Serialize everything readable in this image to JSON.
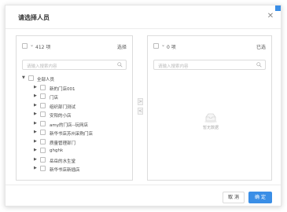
{
  "dialog": {
    "title": "请选择人员",
    "close_symbol": "✕"
  },
  "left_panel": {
    "count_label": "412 项",
    "selected_label": "选择",
    "search_placeholder": "请输入搜索内容",
    "tree": [
      {
        "label": "全部人员"
      },
      {
        "label": "新的门店001"
      },
      {
        "label": "门店"
      },
      {
        "label": "组织部门测试"
      },
      {
        "label": "安阳的小店"
      },
      {
        "label": "amy的门店--玩网店"
      },
      {
        "label": "新华书店苏州采购门店"
      },
      {
        "label": "质量管理部门"
      },
      {
        "label": "ghghk"
      },
      {
        "label": "岳岳的水生堂"
      },
      {
        "label": "新华书店新插店"
      }
    ]
  },
  "right_panel": {
    "count_label": "0 项",
    "selected_label": "已选",
    "search_placeholder": "请输入搜索内容",
    "empty_text": "暂无数据"
  },
  "transfer": {
    "to_right_symbol": ">",
    "to_left_symbol": "<"
  },
  "footer": {
    "cancel_label": "取 消",
    "ok_label": "确 定"
  },
  "colors": {
    "primary": "#3a8ee6",
    "border": "#dcdcdc"
  }
}
